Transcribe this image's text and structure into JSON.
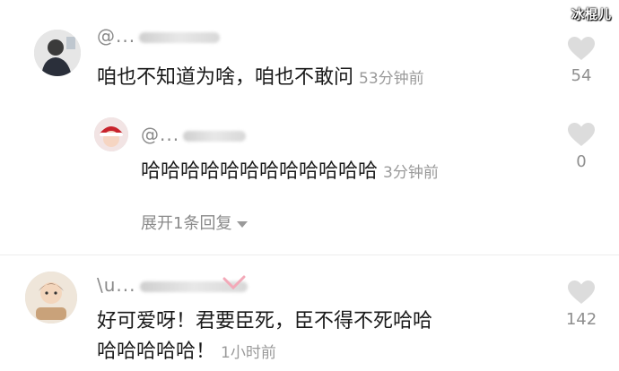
{
  "watermark": "冰棍儿",
  "comments": [
    {
      "username": "@...",
      "avatar_icon": "user-avatar-dark-jacket-icon",
      "text": "咱也不知道为啥，咱也不敢问",
      "time": "53分钟前",
      "likes": "54"
    },
    {
      "username": "@...",
      "avatar_icon": "user-avatar-red-hat-icon",
      "text": "哈哈哈哈哈哈哈哈哈哈哈哈",
      "time": "3分钟前",
      "likes": "0"
    },
    {
      "username": "\\u...",
      "avatar_icon": "user-avatar-illustration-icon",
      "text_line1": "好可爱呀！君要臣死，臣不得不死哈哈",
      "text_line2": "哈哈哈哈哈！",
      "time": "1小时前",
      "likes": "142"
    }
  ],
  "expand_replies": "展开1条回复",
  "icons": {
    "like": "heart-icon",
    "expand": "caret-down-icon"
  },
  "colors": {
    "text": "#1a1a1a",
    "meta": "#9a9a9a",
    "heart": "#dcdcdc"
  }
}
